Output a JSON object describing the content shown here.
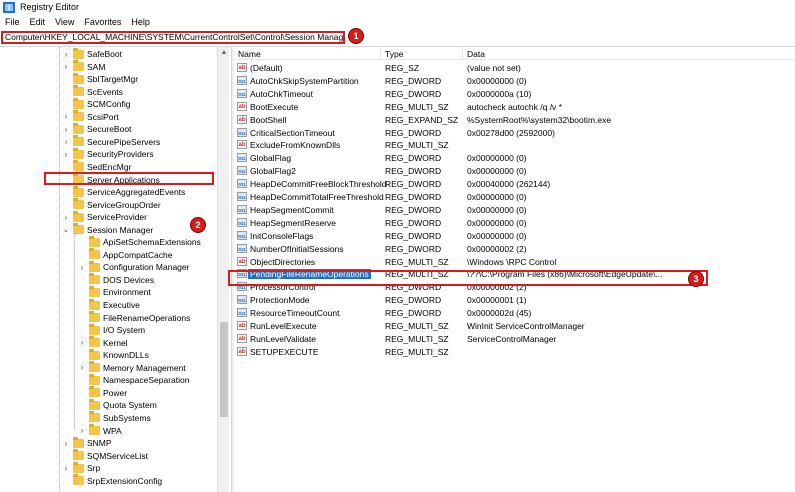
{
  "window": {
    "title": "Registry Editor"
  },
  "menu": [
    "File",
    "Edit",
    "View",
    "Favorites",
    "Help"
  ],
  "address": "Computer\\HKEY_LOCAL_MACHINE\\SYSTEM\\CurrentControlSet\\Control\\Session Manager",
  "badges": [
    "1",
    "2",
    "3"
  ],
  "columns": {
    "name": "Name",
    "type": "Type",
    "data": "Data"
  },
  "tree": [
    {
      "label": "SafeBoot",
      "level": 1,
      "expander": "›"
    },
    {
      "label": "SAM",
      "level": 1,
      "expander": "›"
    },
    {
      "label": "SbITargetMgr",
      "level": 1,
      "expander": ""
    },
    {
      "label": "ScEvents",
      "level": 1,
      "expander": ""
    },
    {
      "label": "SCMConfig",
      "level": 1,
      "expander": ""
    },
    {
      "label": "ScsiPort",
      "level": 1,
      "expander": "›"
    },
    {
      "label": "SecureBoot",
      "level": 1,
      "expander": "›"
    },
    {
      "label": "SecurePipeServers",
      "level": 1,
      "expander": "›"
    },
    {
      "label": "SecurityProviders",
      "level": 1,
      "expander": "›"
    },
    {
      "label": "SedEncMgr",
      "level": 1,
      "expander": ""
    },
    {
      "label": "Server Applications",
      "level": 1,
      "expander": ""
    },
    {
      "label": "ServiceAggregatedEvents",
      "level": 1,
      "expander": ""
    },
    {
      "label": "ServiceGroupOrder",
      "level": 1,
      "expander": ""
    },
    {
      "label": "ServiceProvider",
      "level": 1,
      "expander": "›"
    },
    {
      "label": "Session Manager",
      "level": 1,
      "expander": "⌄"
    },
    {
      "label": "ApiSetSchemaExtensions",
      "level": 2,
      "expander": ""
    },
    {
      "label": "AppCompatCache",
      "level": 2,
      "expander": ""
    },
    {
      "label": "Configuration Manager",
      "level": 2,
      "expander": "›"
    },
    {
      "label": "DOS Devices",
      "level": 2,
      "expander": ""
    },
    {
      "label": "Environment",
      "level": 2,
      "expander": ""
    },
    {
      "label": "Executive",
      "level": 2,
      "expander": ""
    },
    {
      "label": "FileRenameOperations",
      "level": 2,
      "expander": ""
    },
    {
      "label": "I/O System",
      "level": 2,
      "expander": ""
    },
    {
      "label": "Kernel",
      "level": 2,
      "expander": "›"
    },
    {
      "label": "KnownDLLs",
      "level": 2,
      "expander": ""
    },
    {
      "label": "Memory Management",
      "level": 2,
      "expander": "›"
    },
    {
      "label": "NamespaceSeparation",
      "level": 2,
      "expander": ""
    },
    {
      "label": "Power",
      "level": 2,
      "expander": ""
    },
    {
      "label": "Quota System",
      "level": 2,
      "expander": ""
    },
    {
      "label": "SubSystems",
      "level": 2,
      "expander": ""
    },
    {
      "label": "WPA",
      "level": 2,
      "expander": "›"
    },
    {
      "label": "SNMP",
      "level": 1,
      "expander": "›"
    },
    {
      "label": "SQMServiceList",
      "level": 1,
      "expander": ""
    },
    {
      "label": "Srp",
      "level": 1,
      "expander": "›"
    },
    {
      "label": "SrpExtensionConfig",
      "level": 1,
      "expander": ""
    }
  ],
  "values": [
    {
      "icon": "ab",
      "name": "(Default)",
      "type": "REG_SZ",
      "data": "(value not set)"
    },
    {
      "icon": "bin",
      "name": "AutoChkSkipSystemPartition",
      "type": "REG_DWORD",
      "data": "0x00000000 (0)"
    },
    {
      "icon": "bin",
      "name": "AutoChkTimeout",
      "type": "REG_DWORD",
      "data": "0x0000000a (10)"
    },
    {
      "icon": "ab",
      "name": "BootExecute",
      "type": "REG_MULTI_SZ",
      "data": "autocheck autochk /q /v *"
    },
    {
      "icon": "ab",
      "name": "BootShell",
      "type": "REG_EXPAND_SZ",
      "data": "%SystemRoot%\\system32\\bootim.exe"
    },
    {
      "icon": "bin",
      "name": "CriticalSectionTimeout",
      "type": "REG_DWORD",
      "data": "0x00278d00 (2592000)"
    },
    {
      "icon": "ab",
      "name": "ExcludeFromKnownDlls",
      "type": "REG_MULTI_SZ",
      "data": ""
    },
    {
      "icon": "bin",
      "name": "GlobalFlag",
      "type": "REG_DWORD",
      "data": "0x00000000 (0)"
    },
    {
      "icon": "bin",
      "name": "GlobalFlag2",
      "type": "REG_DWORD",
      "data": "0x00000000 (0)"
    },
    {
      "icon": "bin",
      "name": "HeapDeCommitFreeBlockThreshold",
      "type": "REG_DWORD",
      "data": "0x00040000 (262144)"
    },
    {
      "icon": "bin",
      "name": "HeapDeCommitTotalFreeThreshold",
      "type": "REG_DWORD",
      "data": "0x00000000 (0)"
    },
    {
      "icon": "bin",
      "name": "HeapSegmentCommit",
      "type": "REG_DWORD",
      "data": "0x00000000 (0)"
    },
    {
      "icon": "bin",
      "name": "HeapSegmentReserve",
      "type": "REG_DWORD",
      "data": "0x00000000 (0)"
    },
    {
      "icon": "bin",
      "name": "InitConsoleFlags",
      "type": "REG_DWORD",
      "data": "0x00000000 (0)"
    },
    {
      "icon": "bin",
      "name": "NumberOfInitialSessions",
      "type": "REG_DWORD",
      "data": "0x00000002 (2)"
    },
    {
      "icon": "ab",
      "name": "ObjectDirectories",
      "type": "REG_MULTI_SZ",
      "data": "\\Windows \\RPC Control"
    },
    {
      "icon": "bin",
      "name": "PendingFileRenameOperations",
      "type": "REG_MULTI_SZ",
      "data": "\\??\\C:\\Program Files (x86)\\Microsoft\\EdgeUpdate\\..."
    },
    {
      "icon": "bin",
      "name": "ProcessorControl",
      "type": "REG_DWORD",
      "data": "0x00000002 (2)"
    },
    {
      "icon": "bin",
      "name": "ProtectionMode",
      "type": "REG_DWORD",
      "data": "0x00000001 (1)"
    },
    {
      "icon": "bin",
      "name": "ResourceTimeoutCount",
      "type": "REG_DWORD",
      "data": "0x0000002d (45)"
    },
    {
      "icon": "ab",
      "name": "RunLevelExecute",
      "type": "REG_MULTI_SZ",
      "data": "WinInit ServiceControlManager"
    },
    {
      "icon": "ab",
      "name": "RunLevelValidate",
      "type": "REG_MULTI_SZ",
      "data": "ServiceControlManager"
    },
    {
      "icon": "ab",
      "name": "SETUPEXECUTE",
      "type": "REG_MULTI_SZ",
      "data": ""
    }
  ],
  "colors": {
    "accent_red": "#d81c1c",
    "selection": "#1e6fcf",
    "folder": "#f5c54a"
  }
}
